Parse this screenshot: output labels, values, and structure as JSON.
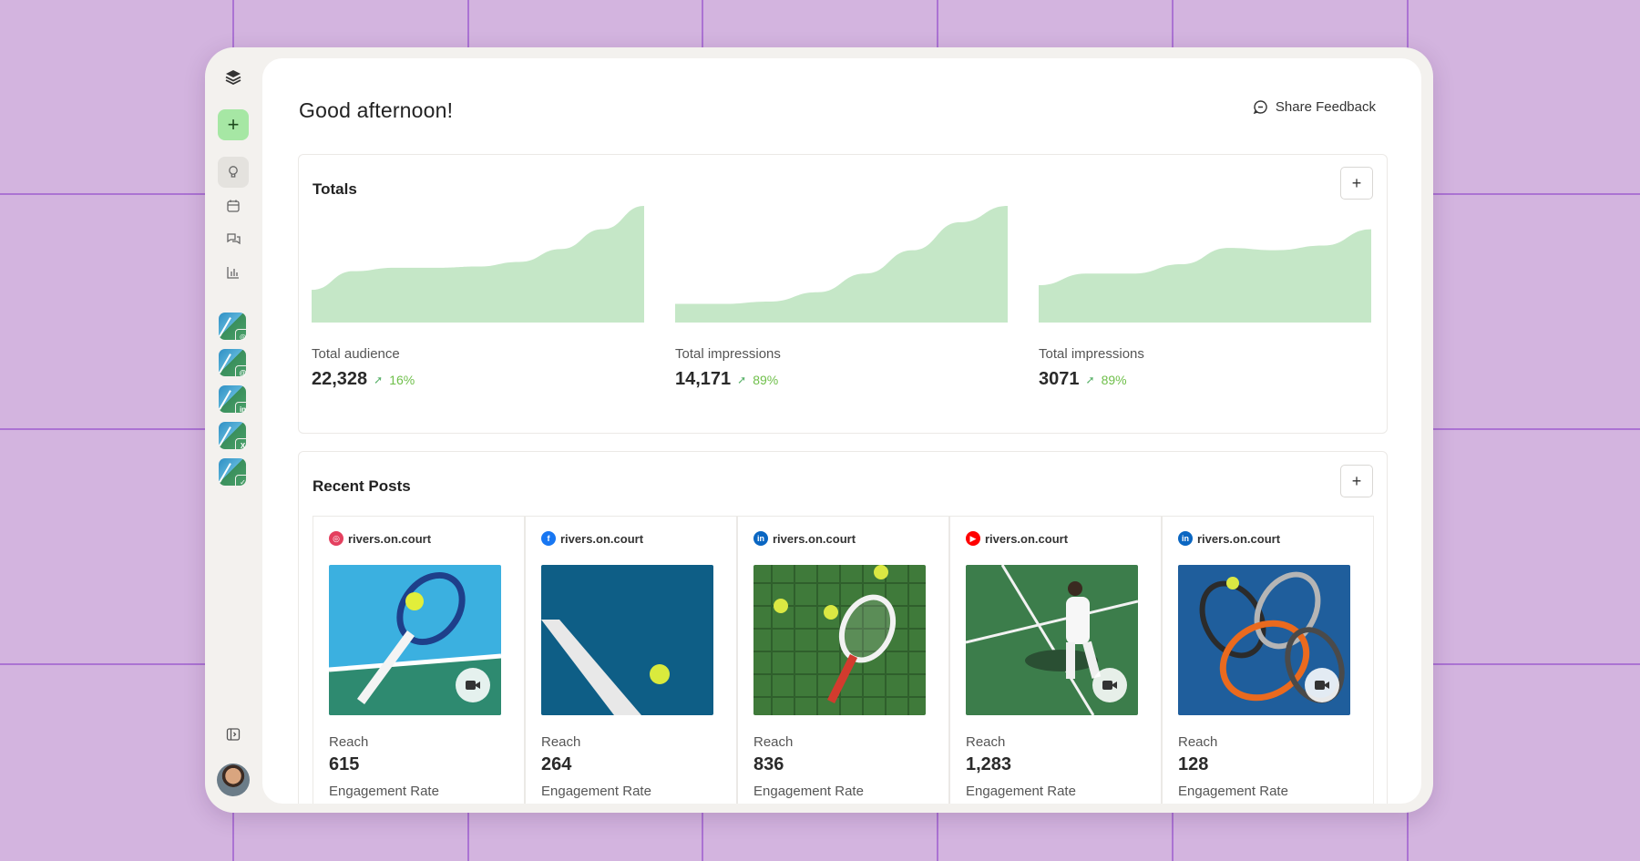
{
  "greeting": "Good afternoon!",
  "share_feedback": "Share Feedback",
  "colors": {
    "accent_green": "#a6e7a4",
    "chart_fill": "#c5e7c7",
    "positive": "#6fbf4a",
    "background": "#d3b4df"
  },
  "sidebar": {
    "logo_icon": "layers-icon",
    "add_icon": "plus-icon",
    "nav": [
      "lightbulb-icon",
      "calendar-icon",
      "chat-icon",
      "bar-chart-icon"
    ],
    "accounts": [
      {
        "platform": "Instagram",
        "badge_color": "#e4405f",
        "glyph": "◎"
      },
      {
        "platform": "Threads",
        "badge_color": "#111111",
        "glyph": "@"
      },
      {
        "platform": "LinkedIn",
        "badge_color": "#0a66c2",
        "glyph": "in"
      },
      {
        "platform": "X",
        "badge_color": "#000000",
        "glyph": "X"
      },
      {
        "platform": "Bluesky",
        "badge_color": "#1185fe",
        "glyph": "✓"
      }
    ]
  },
  "totals": {
    "title": "Totals",
    "add": "+",
    "metrics": [
      {
        "label": "Total audience",
        "value": "22,328",
        "change": "16%",
        "trend": [
          0.28,
          0.44,
          0.47,
          0.47,
          0.48,
          0.52,
          0.63,
          0.8,
          1.0
        ]
      },
      {
        "label": "Total impressions",
        "value": "14,171",
        "change": "89%",
        "trend": [
          0.16,
          0.16,
          0.18,
          0.26,
          0.42,
          0.62,
          0.86,
          1.0
        ]
      },
      {
        "label": "Total impressions",
        "value": "3071",
        "change": "89%",
        "trend": [
          0.32,
          0.42,
          0.42,
          0.5,
          0.64,
          0.62,
          0.66,
          0.8
        ]
      }
    ]
  },
  "recent_posts": {
    "title": "Recent Posts",
    "add": "+",
    "reach_label": "Reach",
    "engagement_label": "Engagement Rate",
    "posts": [
      {
        "platform": "Instagram",
        "color": "#e4405f",
        "glyph": "◎",
        "handle": "rivers.on.court",
        "reach": "615",
        "video": true
      },
      {
        "platform": "Facebook",
        "color": "#1877f2",
        "glyph": "f",
        "handle": "rivers.on.court",
        "reach": "264",
        "video": false
      },
      {
        "platform": "LinkedIn",
        "color": "#0a66c2",
        "glyph": "in",
        "handle": "rivers.on.court",
        "reach": "836",
        "video": false
      },
      {
        "platform": "YouTube",
        "color": "#ff0000",
        "glyph": "▶",
        "handle": "rivers.on.court",
        "reach": "1,283",
        "video": true
      },
      {
        "platform": "LinkedIn",
        "color": "#0a66c2",
        "glyph": "in",
        "handle": "rivers.on.court",
        "reach": "128",
        "video": true
      }
    ]
  }
}
